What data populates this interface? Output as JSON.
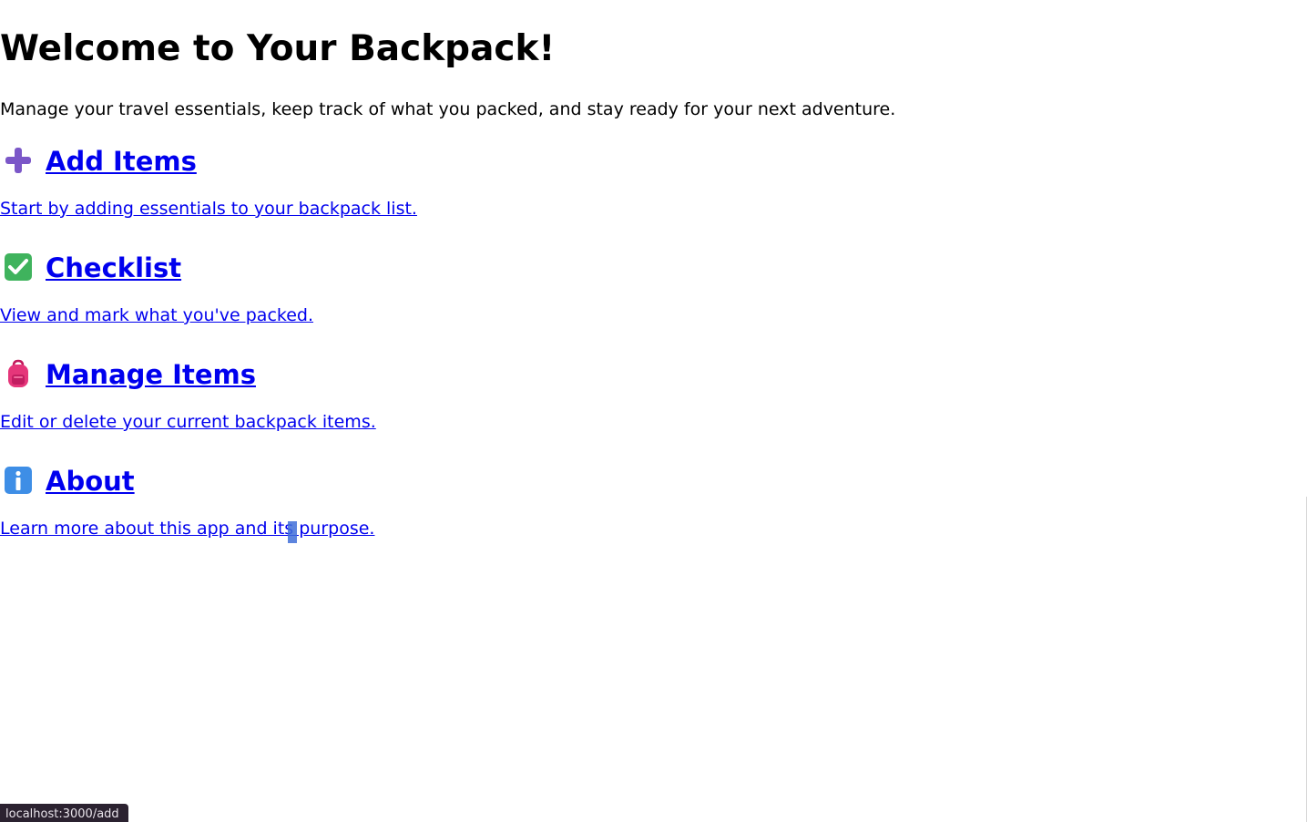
{
  "page": {
    "title": "Welcome to Your Backpack!",
    "intro": "Manage your travel essentials, keep track of what you packed, and stay ready for your next adventure."
  },
  "nav": {
    "add": {
      "icon": "plus-icon",
      "label": "Add Items",
      "description": "Start by adding essentials to your backpack list."
    },
    "checklist": {
      "icon": "check-mark-icon",
      "label": "Checklist",
      "description": "View and mark what you've packed."
    },
    "manage": {
      "icon": "backpack-icon",
      "label": "Manage Items",
      "description": "Edit or delete your current backpack items."
    },
    "about": {
      "icon": "info-icon",
      "label": "About",
      "description": "Learn more about this app and its purpose."
    }
  },
  "status_bar": {
    "url": "localhost:3000/add"
  },
  "colors": {
    "link": "#0000ee",
    "text": "#000000",
    "status_bg": "#2b2230"
  }
}
